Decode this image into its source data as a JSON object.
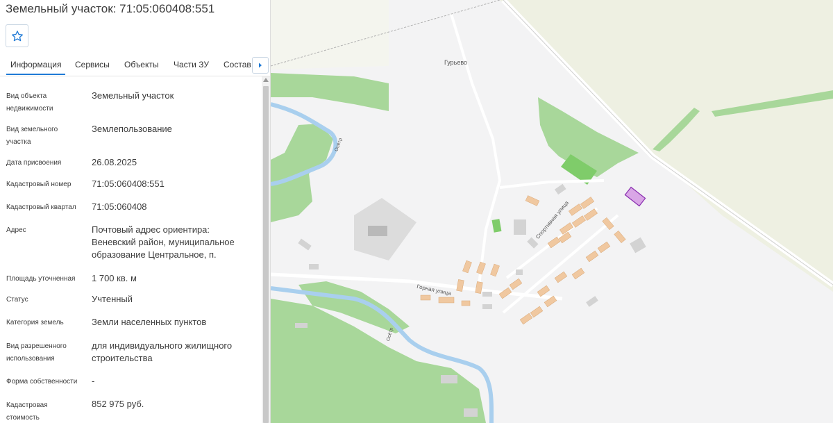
{
  "header": {
    "title": "Земельный участок: 71:05:060408:551"
  },
  "tabs": [
    {
      "label": "Информация"
    },
    {
      "label": "Сервисы"
    },
    {
      "label": "Объекты"
    },
    {
      "label": "Части ЗУ"
    },
    {
      "label": "Состав"
    }
  ],
  "properties": [
    {
      "label": "Вид объекта недвижимости",
      "value": "Земельный участок"
    },
    {
      "label": "Вид земельного участка",
      "value": "Землепользование"
    },
    {
      "label": "Дата присвоения",
      "value": "26.08.2025"
    },
    {
      "label": "Кадастровый номер",
      "value": "71:05:060408:551"
    },
    {
      "label": "Кадастровый квартал",
      "value": "71:05:060408"
    },
    {
      "label": "Адрес",
      "value": "Почтовый адрес ориентира: Веневский район, муниципальное образование Центральное, п."
    },
    {
      "label": "Площадь уточненная",
      "value": "1 700 кв. м"
    },
    {
      "label": "Статус",
      "value": "Учтенный"
    },
    {
      "label": "Категория земель",
      "value": "Земли населенных пунктов"
    },
    {
      "label": "Вид разрешенного использования",
      "value": "для индивидуального жилищного строительства"
    },
    {
      "label": "Форма собственности",
      "value": "-"
    },
    {
      "label": "Кадастровая стоимость",
      "value": "852 975 руб."
    }
  ],
  "map": {
    "village_label": "Гурьево",
    "street_1": "Горная улица",
    "street_2": "Спортивная улица",
    "river_label": "Осётр"
  },
  "colors": {
    "accent": "#1f7ad6",
    "forest": "#a8d79a",
    "river": "#a9cfee",
    "building": "#f0c8a0",
    "parcel": "#d9a6e6"
  }
}
